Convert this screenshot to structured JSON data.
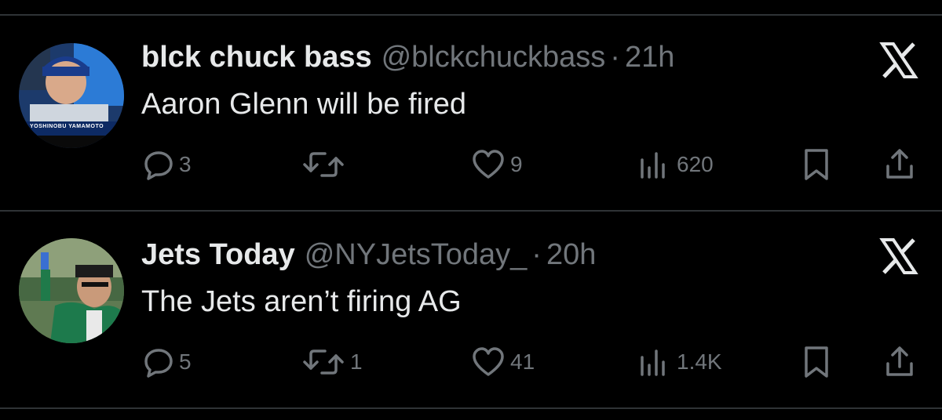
{
  "colors": {
    "background": "#000000",
    "primary_text": "#e7e9ea",
    "secondary_text": "#71767b",
    "divider": "#2f3336"
  },
  "tweets": [
    {
      "display_name": "blck chuck bass",
      "handle": "@blckchuckbass",
      "separator": "·",
      "time": "21h",
      "text": "Aaron Glenn will be fired",
      "replies": "3",
      "retweets": "",
      "likes": "9",
      "views": "620",
      "avatar_overlay_text": "YOSHINOBU YAMAMOTO"
    },
    {
      "display_name": "Jets Today",
      "handle": "@NYJetsToday_",
      "separator": "·",
      "time": "20h",
      "text": "The Jets aren’t firing AG",
      "replies": "5",
      "retweets": "1",
      "likes": "41",
      "views": "1.4K"
    }
  ],
  "icons": {
    "reply": "reply-icon",
    "retweet": "retweet-icon",
    "like": "heart-icon",
    "views": "views-icon",
    "bookmark": "bookmark-icon",
    "share": "share-icon",
    "brand": "x-logo-icon"
  }
}
